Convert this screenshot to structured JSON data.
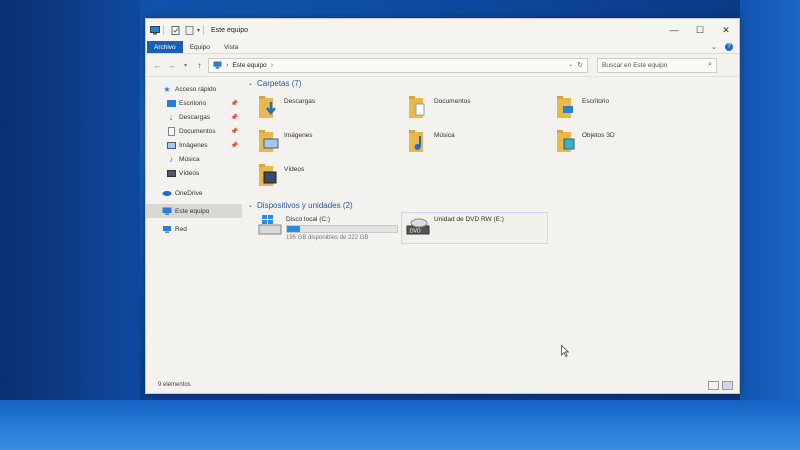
{
  "window": {
    "title": "Este equipo",
    "controls": {
      "minimize": "—",
      "maximize": "☐",
      "close": "✕"
    }
  },
  "ribbon": {
    "tabs": [
      "Archivo",
      "Equipo",
      "Vista"
    ],
    "expand_icon": "chevron-down-icon",
    "help_icon": "question-icon"
  },
  "address": {
    "path": "Este equipo",
    "separator": "›",
    "refresh_icon": "refresh-icon",
    "search_placeholder": "Buscar en Este equipo"
  },
  "sidebar": {
    "quick_access": "Acceso rápido",
    "quick_items": [
      {
        "label": "Escritorio",
        "pinned": true
      },
      {
        "label": "Descargas",
        "pinned": true
      },
      {
        "label": "Documentos",
        "pinned": true
      },
      {
        "label": "Imágenes",
        "pinned": true
      },
      {
        "label": "Música",
        "pinned": false
      },
      {
        "label": "Vídeos",
        "pinned": false
      }
    ],
    "onedrive": "OneDrive",
    "this_pc": "Este equipo",
    "network": "Red"
  },
  "content": {
    "folders_header": "Carpetas (7)",
    "folders": [
      "Descargas",
      "Documentos",
      "Escritorio",
      "Imágenes",
      "Música",
      "Objetos 3D",
      "Vídeos"
    ],
    "devices_header": "Dispositivos y unidades (2)",
    "drives": [
      {
        "name": "Disco local (C:)",
        "free_text": "195 GB disponibles de 222 GB",
        "used_fraction": 0.12
      },
      {
        "name": "Unidad de DVD RW (E:)",
        "dvd_label": "DVD"
      }
    ]
  },
  "status": {
    "items": "9 elementos"
  },
  "colors": {
    "accent": "#1a5fb4",
    "folder": "#e8b84a",
    "drive_bar": "#2b8be0"
  }
}
